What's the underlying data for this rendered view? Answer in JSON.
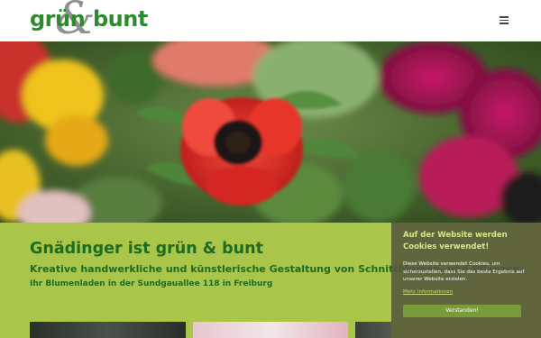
{
  "header": {
    "logo": {
      "word1": "grün",
      "amp": "&",
      "word2": "bunt"
    },
    "menu_icon": "hamburger-menu-icon"
  },
  "hero": {
    "image": "flower-bouquet-photo"
  },
  "intro": {
    "title": "Gnädinger ist grün & bunt",
    "subtitle": "Kreative handwerkliche und künstlerische Gestaltung von Schnittblumen- und Pflanzen",
    "address_line": "Ihr Blumenladen in der Sundgauallee 118 in Freiburg"
  },
  "cookie_banner": {
    "title": "Auf der Website werden Cookies verwendet!",
    "text": "Diese Website verwendet Cookies, um sicherzustellen, dass Sie das beste Ergebnis auf unserer Website erzielen.",
    "link_label": "Mehr Informationen",
    "accept_label": "Verstanden!"
  },
  "colors": {
    "brand_green": "#2e8a2e",
    "band_green": "#a9c54a",
    "heading_green": "#1f6b1f",
    "cookie_bg": "#55553c",
    "cookie_button": "#7a9b3a"
  }
}
